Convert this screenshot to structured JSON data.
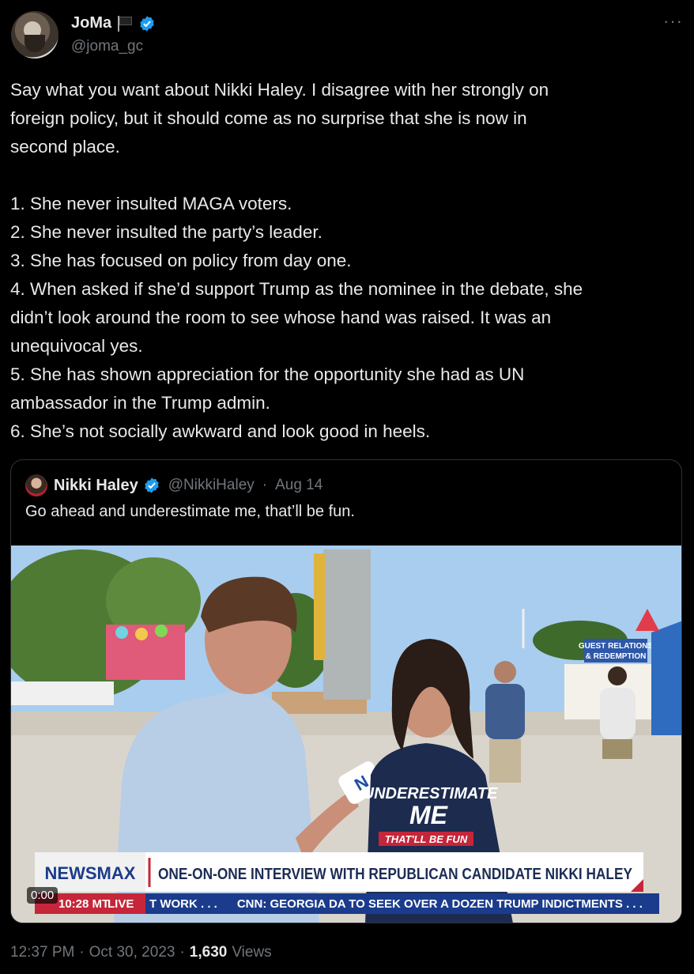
{
  "author": {
    "name": "JoMa",
    "handle": "@joma_gc",
    "flag_icon": "black-flag-icon",
    "verified_color": "#1d9bf0"
  },
  "more_label": "···",
  "tweet": {
    "lines": [
      "Say what you want about Nikki Haley. I disagree with her strongly on",
      "foreign policy, but it should come as no surprise that she is now in",
      "second place.",
      "",
      "1. She never insulted MAGA voters.",
      "2. She never insulted the party’s leader.",
      "3. She has focused on policy from day one.",
      "4. When asked if she’d support Trump as the nominee in the debate, she",
      "didn’t look around the room to see whose hand was raised. It was an",
      "unequivocal yes.",
      "5. She has shown appreciation for the opportunity she had as UN",
      "ambassador in the Trump admin.",
      "6. She’s not socially awkward and look good in heels."
    ]
  },
  "quoted": {
    "name": "Nikki Haley",
    "handle": "@NikkiHaley",
    "separator": "·",
    "date": "Aug 14",
    "text": "Go ahead and underestimate me, that’ll be fun.",
    "video": {
      "duration": "0:00",
      "banner_logo": "NEWSMAX",
      "banner_headline": "ONE-ON-ONE INTERVIEW WITH REPUBLICAN CANDIDATE NIKKI HALEY",
      "ticker_time": "10:28 MT",
      "ticker_live": "LIVE",
      "ticker_text": "T WORK . . .      CNN: GEORGIA DA TO SEEK OVER A DOZEN TRUMP INDICTMENTS . . .",
      "sign_text_1": "GUEST RELATIONS",
      "sign_text_2": "& REDEMPTION",
      "shirt_line_1": "UNDERESTIMATE",
      "shirt_line_2": "ME",
      "shirt_line_3": "THAT'LL BE FUN",
      "mic_logo": "N"
    }
  },
  "footer": {
    "time": "12:37 PM",
    "sep1": "·",
    "date": "Oct 30, 2023",
    "sep2": "·",
    "views_count": "1,630",
    "views_label": "Views"
  }
}
